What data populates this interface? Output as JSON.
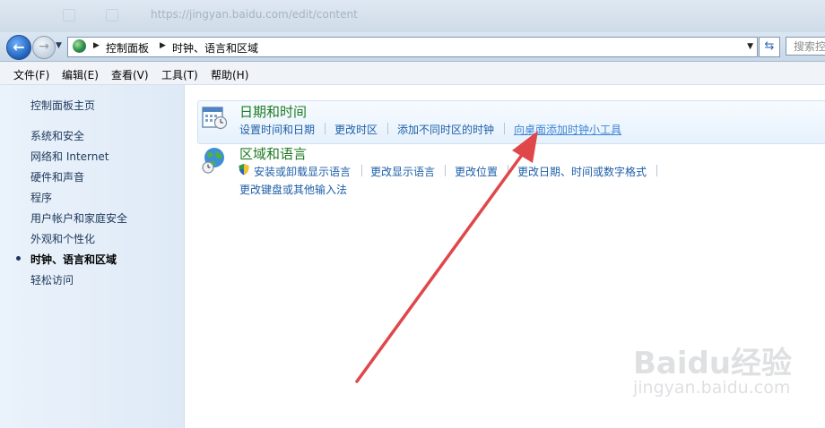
{
  "titlebar": {
    "text": "https://jingyan.baidu.com/edit/content"
  },
  "address": {
    "crumbs": [
      "控制面板",
      "时钟、语言和区域"
    ],
    "search_placeholder": "搜索控"
  },
  "menu": [
    "文件(F)",
    "编辑(E)",
    "查看(V)",
    "工具(T)",
    "帮助(H)"
  ],
  "sidebar": {
    "home": "控制面板主页",
    "items": [
      "系统和安全",
      "网络和 Internet",
      "硬件和声音",
      "程序",
      "用户帐户和家庭安全",
      "外观和个性化",
      "时钟、语言和区域",
      "轻松访问"
    ]
  },
  "categories": [
    {
      "title": "日期和时间",
      "links": [
        "设置时间和日期",
        "更改时区",
        "添加不同时区的时钟",
        "向桌面添加时钟小工具"
      ]
    },
    {
      "title": "区域和语言",
      "links": [
        "安装或卸载显示语言",
        "更改显示语言",
        "更改位置",
        "更改日期、时间或数字格式",
        "更改键盘或其他输入法"
      ]
    }
  ],
  "watermark": {
    "logo": "Baidu经验",
    "url": "jingyan.baidu.com"
  },
  "colors": {
    "annotation_arrow": "#e0474b",
    "category_title": "#1e7b22",
    "link": "#1e5fa8"
  }
}
